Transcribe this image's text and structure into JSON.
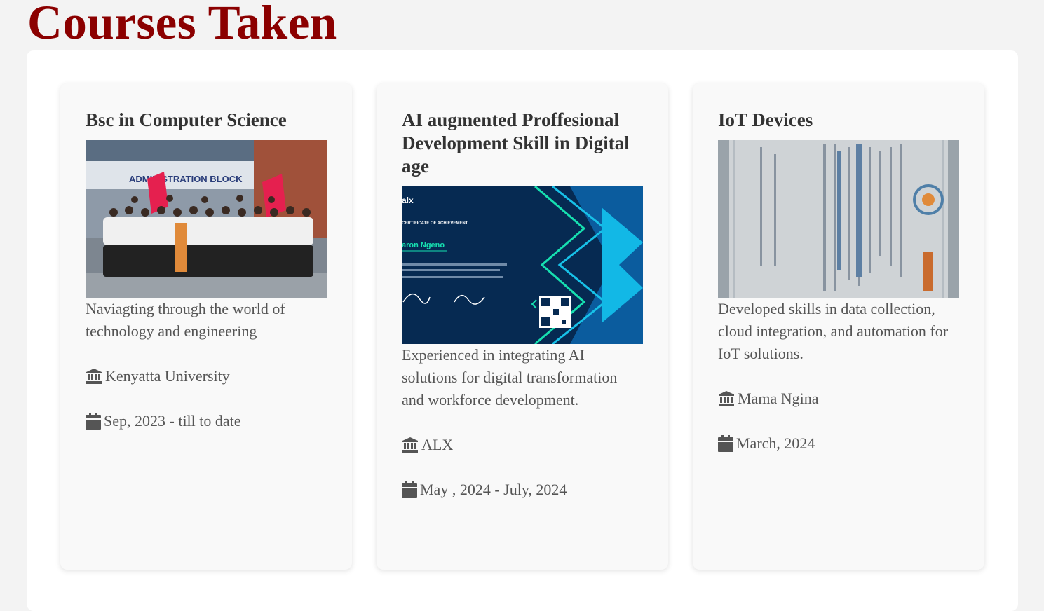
{
  "section": {
    "title": "Courses Taken"
  },
  "courses": [
    {
      "title": "Bsc in Computer Science",
      "image_label": "ADMINISTRATION BLOCK",
      "description": "Naviagting through the world of technology and engineering",
      "institution": "Kenyatta University",
      "date": "Sep, 2023 - till to date"
    },
    {
      "title": "AI augmented Proffesional Development Skill in Digital age",
      "image_label": "alx",
      "image_subtitle": "CERTIFICATE OF ACHIEVEMENT",
      "image_name": "aron Ngeno",
      "description": "Experienced in integrating AI solutions for digital transformation and workforce development.",
      "institution": "ALX",
      "date": "May , 2024 - July, 2024"
    },
    {
      "title": "IoT Devices",
      "description": "Developed skills in data collection, cloud integration, and automation for IoT solutions.",
      "institution": "Mama Ngina",
      "date": "March, 2024"
    }
  ],
  "colors": {
    "title": "#8b0000",
    "card_bg": "#f9f9f9",
    "icon": "#555555"
  },
  "icons": {
    "institution": "university-icon",
    "date": "calendar-icon"
  }
}
